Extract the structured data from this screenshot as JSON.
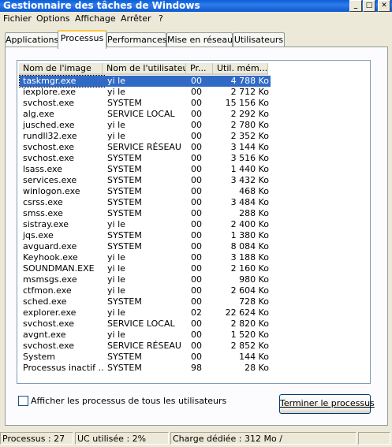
{
  "window": {
    "title": "Gestionnaire des tâches de Windows",
    "min_glyph": "_",
    "max_glyph": "□",
    "close_glyph": "✕"
  },
  "menu": [
    "Fichier",
    "Options",
    "Affichage",
    "Arrêter",
    "?"
  ],
  "tabs": [
    "Applications",
    "Processus",
    "Performances",
    "Mise en réseau",
    "Utilisateurs"
  ],
  "active_tab": "Processus",
  "columns": [
    "Nom de l'image",
    "Nom de l'utilisateur",
    "Pr...",
    "Util. mém..."
  ],
  "processes": [
    {
      "name": "taskmgr.exe",
      "user": "yi le",
      "cpu": "00",
      "mem": "4 788 Ko",
      "selected": true
    },
    {
      "name": "iexplore.exe",
      "user": "yi le",
      "cpu": "00",
      "mem": "2 712 Ko"
    },
    {
      "name": "svchost.exe",
      "user": "SYSTEM",
      "cpu": "00",
      "mem": "15 156 Ko"
    },
    {
      "name": "alg.exe",
      "user": "SERVICE LOCAL",
      "cpu": "00",
      "mem": "2 292 Ko"
    },
    {
      "name": "jusched.exe",
      "user": "yi le",
      "cpu": "00",
      "mem": "2 780 Ko"
    },
    {
      "name": "rundll32.exe",
      "user": "yi le",
      "cpu": "00",
      "mem": "2 352 Ko"
    },
    {
      "name": "svchost.exe",
      "user": "SERVICE RÉSEAU",
      "cpu": "00",
      "mem": "3 144 Ko"
    },
    {
      "name": "svchost.exe",
      "user": "SYSTEM",
      "cpu": "00",
      "mem": "3 516 Ko"
    },
    {
      "name": "lsass.exe",
      "user": "SYSTEM",
      "cpu": "00",
      "mem": "1 440 Ko"
    },
    {
      "name": "services.exe",
      "user": "SYSTEM",
      "cpu": "00",
      "mem": "3 432 Ko"
    },
    {
      "name": "winlogon.exe",
      "user": "SYSTEM",
      "cpu": "00",
      "mem": "468 Ko"
    },
    {
      "name": "csrss.exe",
      "user": "SYSTEM",
      "cpu": "00",
      "mem": "3 484 Ko"
    },
    {
      "name": "smss.exe",
      "user": "SYSTEM",
      "cpu": "00",
      "mem": "288 Ko"
    },
    {
      "name": "sistray.exe",
      "user": "yi le",
      "cpu": "00",
      "mem": "2 400 Ko"
    },
    {
      "name": "jqs.exe",
      "user": "SYSTEM",
      "cpu": "00",
      "mem": "1 380 Ko"
    },
    {
      "name": "avguard.exe",
      "user": "SYSTEM",
      "cpu": "00",
      "mem": "8 084 Ko"
    },
    {
      "name": "Keyhook.exe",
      "user": "yi le",
      "cpu": "00",
      "mem": "3 188 Ko"
    },
    {
      "name": "SOUNDMAN.EXE",
      "user": "yi le",
      "cpu": "00",
      "mem": "2 160 Ko"
    },
    {
      "name": "msmsgs.exe",
      "user": "yi le",
      "cpu": "00",
      "mem": "980 Ko"
    },
    {
      "name": "ctfmon.exe",
      "user": "yi le",
      "cpu": "00",
      "mem": "2 604 Ko"
    },
    {
      "name": "sched.exe",
      "user": "SYSTEM",
      "cpu": "00",
      "mem": "728 Ko"
    },
    {
      "name": "explorer.exe",
      "user": "yi le",
      "cpu": "02",
      "mem": "22 624 Ko"
    },
    {
      "name": "svchost.exe",
      "user": "SERVICE LOCAL",
      "cpu": "00",
      "mem": "2 820 Ko"
    },
    {
      "name": "avgnt.exe",
      "user": "yi le",
      "cpu": "00",
      "mem": "1 520 Ko"
    },
    {
      "name": "svchost.exe",
      "user": "SERVICE RÉSEAU",
      "cpu": "00",
      "mem": "2 852 Ko"
    },
    {
      "name": "System",
      "user": "SYSTEM",
      "cpu": "00",
      "mem": "144 Ko"
    },
    {
      "name": "Processus inactif ...",
      "user": "SYSTEM",
      "cpu": "98",
      "mem": "28 Ko"
    }
  ],
  "show_all_users_label": "Afficher les processus de tous les utilisateurs",
  "end_process_button": "Terminer le processus",
  "status": {
    "processes": "Processus : 27",
    "cpu": "UC utilisée : 2%",
    "commit": "Charge dédiée : 312 Mo /"
  },
  "colors": {
    "title_bar": "#0A5FD8",
    "selection": "#316AC5",
    "face": "#ECE9D8"
  }
}
